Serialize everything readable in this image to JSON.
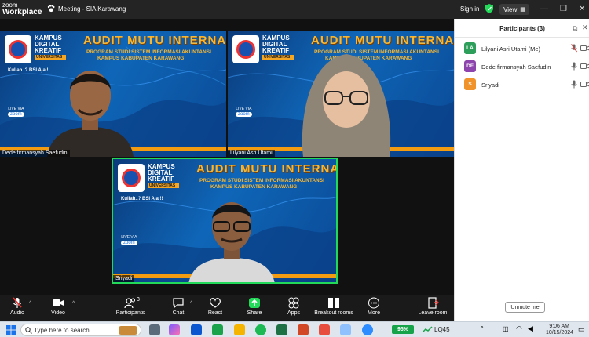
{
  "titlebar": {
    "brand_line1": "zoom",
    "brand_line2": "Workplace",
    "meeting_title": "Meeting - SIA Karawang",
    "sign_in": "Sign in",
    "view": "View"
  },
  "slides": {
    "logo_text": "KAMPUS DIGITAL KREATIF",
    "logo_sub": "UNIVERSITAS",
    "kuliah": "Kuliah..? BSI Aja !!",
    "heading": "AUDIT MUTU INTERNAL",
    "program": "PROGRAM STUDI SISTEM INFORMASI AKUNTANSI",
    "campus": "KAMPUS KABUPATEN KARAWANG",
    "live_via": "LIVE VIA",
    "zoom": "zoom"
  },
  "tiles": [
    {
      "name": "Dede firmansyah Saefudin"
    },
    {
      "name": "Lilyani Asri Utami"
    },
    {
      "name": "Sriyadi"
    }
  ],
  "controls": {
    "audio": "Audio",
    "video": "Video",
    "participants": "Participants",
    "participants_count": "3",
    "chat": "Chat",
    "react": "React",
    "share": "Share",
    "apps": "Apps",
    "breakout": "Breakout rooms",
    "more": "More",
    "leave": "Leave room"
  },
  "panel": {
    "title": "Participants (3)",
    "participants": [
      {
        "initials": "LA",
        "name": "Lilyani Asri Utami (Me)",
        "color": "#2e9e5b",
        "muted": true
      },
      {
        "initials": "DF",
        "name": "Dede firmansyah Saefudin",
        "color": "#8e44ad",
        "muted": false
      },
      {
        "initials": "S",
        "name": "Sriyadi",
        "color": "#f0932b",
        "muted": false
      }
    ],
    "unmute_me": "Unmute me"
  },
  "taskbar": {
    "search_placeholder": "Type here to search",
    "battery": "95%",
    "ticker": "LQ45",
    "time": "9:06 AM",
    "date": "10/15/2024"
  },
  "colors": {
    "accent_green": "#23d959",
    "slide_gold": "#f7b733",
    "slide_blue": "#0f66b8"
  }
}
